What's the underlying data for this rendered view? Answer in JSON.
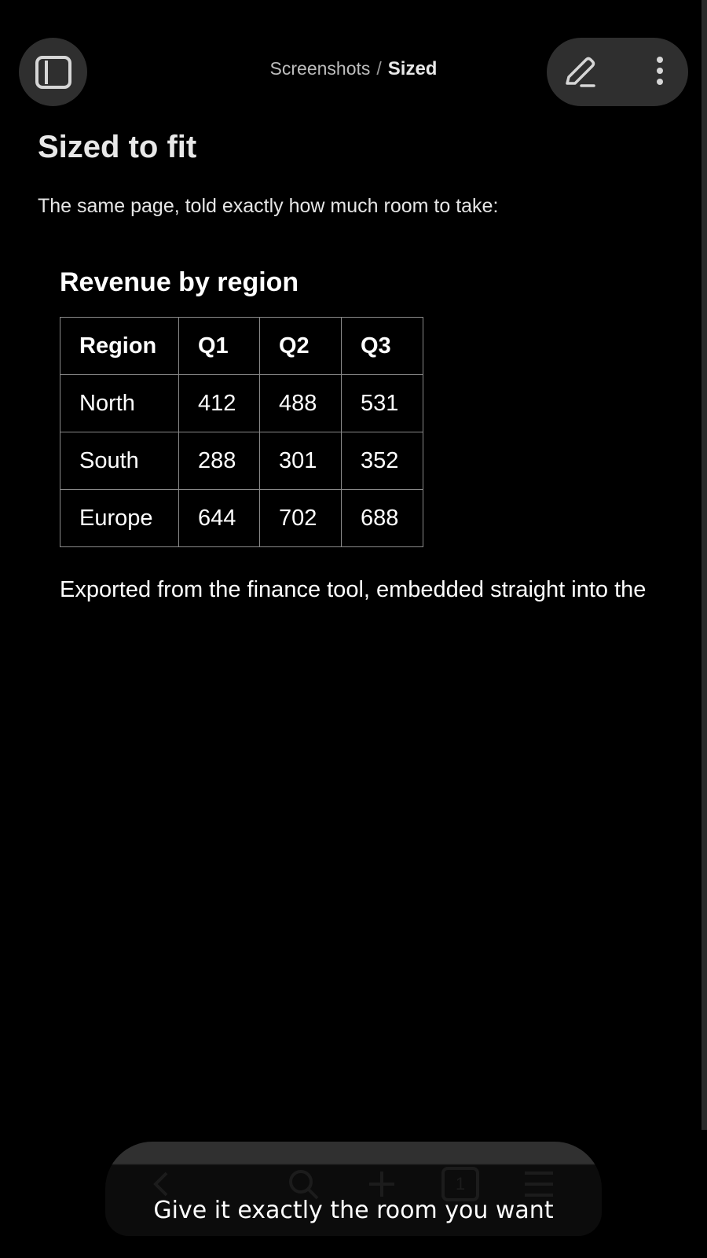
{
  "header": {
    "breadcrumb_parent": "Screenshots",
    "breadcrumb_separator": "/",
    "breadcrumb_current": "Sized",
    "left_button_icon": "sidebar-panel-icon",
    "edit_icon": "pencil-icon",
    "more_icon": "more-vertical-icon"
  },
  "page": {
    "title": "Sized to fit",
    "subtitle": "The same page, told exactly how much room to take:"
  },
  "embed": {
    "title": "Revenue by region",
    "table": {
      "headers": [
        "Region",
        "Q1",
        "Q2",
        "Q3"
      ],
      "rows": [
        [
          "North",
          "412",
          "488",
          "531"
        ],
        [
          "South",
          "288",
          "301",
          "352"
        ],
        [
          "Europe",
          "644",
          "702",
          "688"
        ]
      ]
    },
    "note": "Exported from the finance tool, embedded straight into the"
  },
  "toolbar": {
    "icons": [
      "back-icon",
      "search-icon",
      "plus-icon",
      "tabs-icon",
      "menu-icon"
    ],
    "tab_count": "1"
  },
  "caption": "Give it exactly the room you want",
  "colors": {
    "background": "#000000",
    "button_bg": "#2f2f2f",
    "table_border": "#8a8a8a"
  }
}
